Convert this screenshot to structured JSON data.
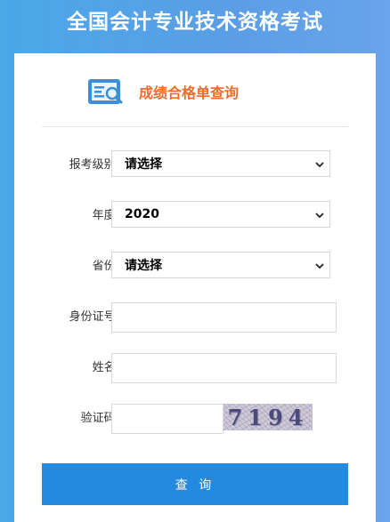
{
  "header": {
    "title": "全国会计专业技术资格考试"
  },
  "card": {
    "title": "成绩合格单查询"
  },
  "form": {
    "level": {
      "label": "报考级别:",
      "value": "请选择"
    },
    "year": {
      "label": "年度:",
      "value": "2020"
    },
    "province": {
      "label": "省份:",
      "value": "请选择"
    },
    "id_number": {
      "label": "身份证号:",
      "value": ""
    },
    "name": {
      "label": "姓名:",
      "value": ""
    },
    "captcha": {
      "label": "验证码:",
      "value": "",
      "image_text": "7194"
    }
  },
  "submit_label": "查 询",
  "colors": {
    "accent": "#2589e0",
    "title_orange": "#f26b2b"
  },
  "icons": {
    "card_icon": "search-document-icon",
    "select_arrow": "chevron-down-icon"
  }
}
